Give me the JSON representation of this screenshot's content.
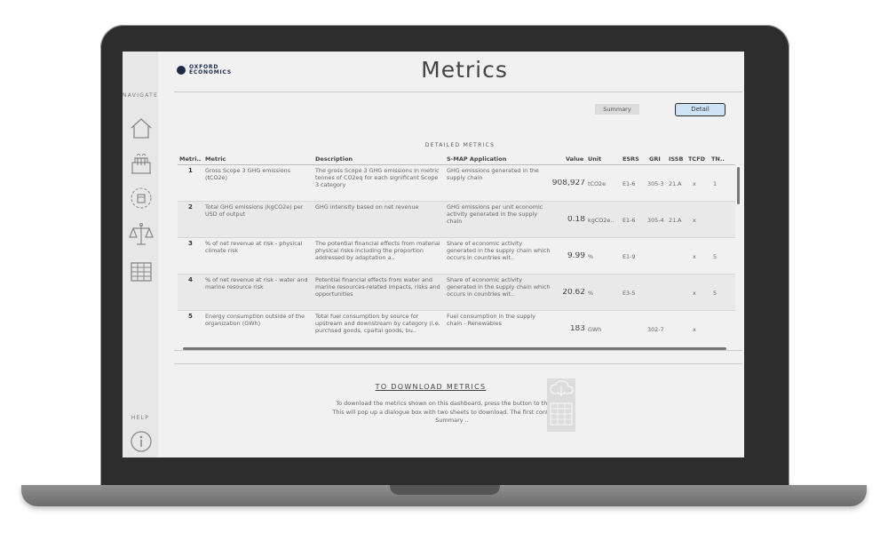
{
  "app": {
    "title": "Metrics",
    "logo_line1": "OXFORD",
    "logo_line2": "ECONOMICS",
    "nav_label": "NAVIGATE",
    "help_label": "HELP"
  },
  "nav": {
    "items": [
      {
        "icon": "home-icon"
      },
      {
        "icon": "factory-icon"
      },
      {
        "icon": "supply-chain-icon"
      },
      {
        "icon": "scales-icon"
      },
      {
        "icon": "table-icon"
      }
    ],
    "help_icon": "info-icon"
  },
  "toggle": {
    "summary_label": "Summary",
    "detail_label": "Detail",
    "selected": "Detail"
  },
  "table": {
    "title": "DETAILED METRICS",
    "columns": [
      "Metri..",
      "Metric",
      "Description",
      "S-MAP Application",
      "Value",
      "Unit",
      "ESRS",
      "GRI",
      "ISSB",
      "TCFD",
      "TN.."
    ],
    "rows": [
      {
        "id": "1",
        "metric": "Gross Scope 3 GHG emissions (tCO2e)",
        "description": "The gross Scope 3 GHG emissions in metric tonnes of CO2eq for each significant Scope 3 category",
        "smap": "GHG emissions generated in the supply chain",
        "value": "908,927",
        "unit": "tCO2e",
        "esrs": "E1-6",
        "gri": "305-3",
        "issb": "21.A",
        "tcfd": "x",
        "tn": "1"
      },
      {
        "id": "2",
        "metric": "Total GHG emissions (kgCO2e) per USD of output",
        "description": "GHG intensity based on net revenue",
        "smap": "GHG emissions per unit economic activity generated in the supply chain",
        "value": "0.18",
        "unit": "kgCO2e..",
        "esrs": "E1-6",
        "gri": "305-4",
        "issb": "21.A",
        "tcfd": "x",
        "tn": ""
      },
      {
        "id": "3",
        "metric": "% of net revenue at risk - physical climate risk",
        "description": "The potential financial effects from material physical risks including the proportion addressed by adaptation a..",
        "smap": "Share of economic activity generated in the supply chain which occurs in countries wit..",
        "value": "9.99",
        "unit": "%",
        "esrs": "E1-9",
        "gri": "",
        "issb": "",
        "tcfd": "x",
        "tn": "5"
      },
      {
        "id": "4",
        "metric": "% of net revenue at risk - water and marine resource risk",
        "description": "Potential financial effects from water and marine resources-related impacts, risks and opportunities",
        "smap": "Share of economic activity generated in the supply chain which occurs in countries wit..",
        "value": "20.62",
        "unit": "%",
        "esrs": "E3-5",
        "gri": "",
        "issb": "",
        "tcfd": "x",
        "tn": "5"
      },
      {
        "id": "5",
        "metric": "Energy consumption outside of the organization (GWh)",
        "description": "Total fuel consumption by source for upstream and downstream by category (i.e. purchsed goods, cpaital goods, bu..",
        "smap": "Fuel consumption in the supply chain - Renewables",
        "value": "183",
        "unit": "GWh",
        "esrs": "",
        "gri": "302-7",
        "issb": "",
        "tcfd": "x",
        "tn": ""
      }
    ]
  },
  "download": {
    "title": "TO DOWNLOAD METRICS",
    "text": "To download the metrics shown on this dashboard, press the button to the right. This will pop up a dialogue box with two sheets to download. The first contains the Summary ..",
    "icon": "download-spreadsheet-icon"
  }
}
